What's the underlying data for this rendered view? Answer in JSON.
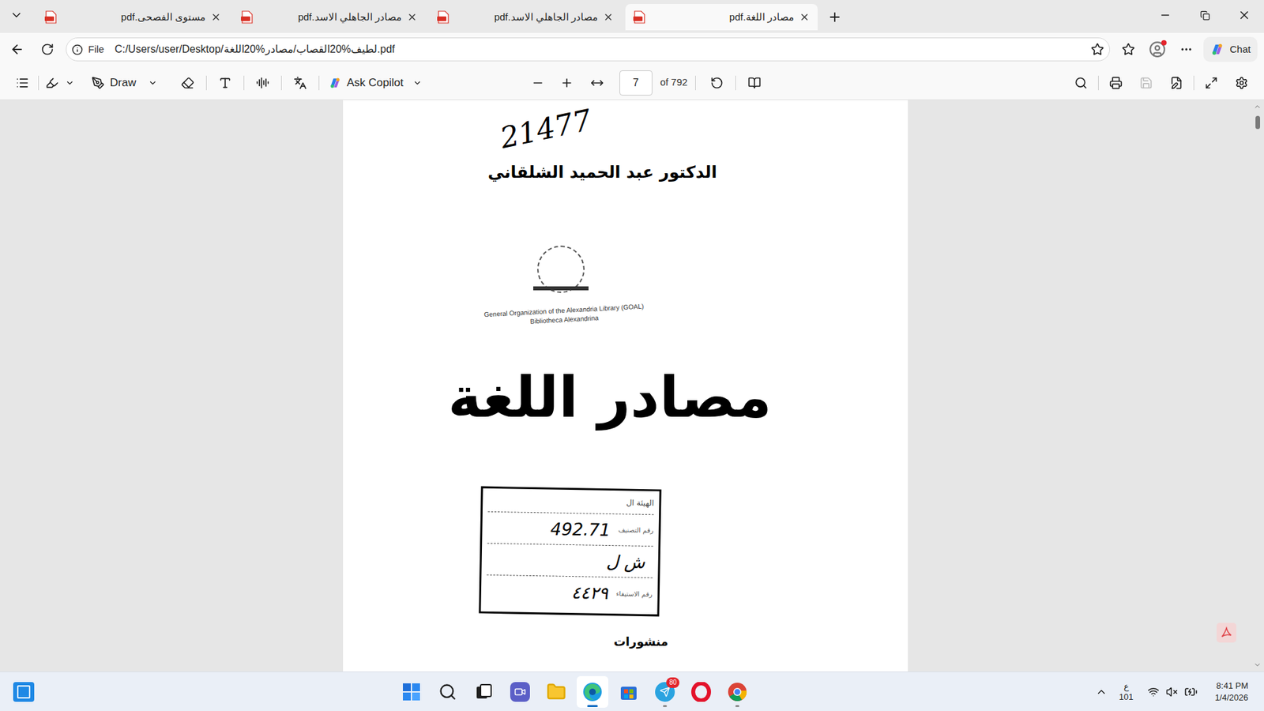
{
  "tab_strip": {
    "tabs": [
      {
        "title": "مستوى الفصحى.pdf",
        "selected": false
      },
      {
        "title": "مصادر الجاهلي الاسد.pdf",
        "selected": false
      },
      {
        "title": "مصادر الجاهلي الاسد.pdf",
        "selected": false
      },
      {
        "title": "مصادر اللغة.pdf",
        "selected": true
      }
    ]
  },
  "address_bar": {
    "scheme": "File",
    "url": "C:/Users/user/Desktop/لطيف%20القصاب/مصادر%20اللغة.pdf",
    "profile_notification": true
  },
  "chat_button": "Chat",
  "pdf_toolbar": {
    "draw": "Draw",
    "copilot": "Ask Copilot",
    "page": "7",
    "page_count": "of 792",
    "save_disabled": true
  },
  "document": {
    "handwritten_number": "21477",
    "author": "الدكتور عبد الحميد الشلقاني",
    "library_stamp": [
      "General Organization of the Alexandria Library (GOAL)",
      "Bibliotheca Alexandrina"
    ],
    "title": "مصادر اللغة",
    "catalog_stamp": {
      "header": "الهيئة ال",
      "rows": [
        {
          "label": "رقم التصنيف",
          "value": "492.71"
        },
        {
          "label": "",
          "value": "ش ل"
        },
        {
          "label": "رقم الاستيفاء",
          "value": "٤٤٢٩"
        }
      ]
    },
    "publisher_line": "منشورات"
  },
  "scrollbar": {
    "level": 0.01
  },
  "taskbar": {
    "apps": [
      {
        "running": false,
        "active": false
      },
      {
        "running": false,
        "active": false
      },
      {
        "running": false,
        "active": false
      },
      {
        "running": false,
        "active": false
      },
      {
        "running": false,
        "active": false
      },
      {
        "running": true,
        "active": true
      },
      {
        "running": false,
        "active": false
      },
      {
        "running": true,
        "active": false
      },
      {
        "running": false,
        "active": false
      },
      {
        "running": true,
        "active": false
      }
    ],
    "telegram_badge": "80",
    "input_language": "ع",
    "input_layout": "101",
    "time": "8:41 PM",
    "date": "1/4/2026"
  }
}
